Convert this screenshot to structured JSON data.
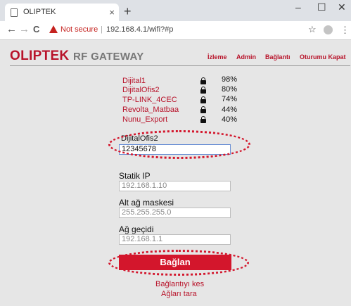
{
  "browser": {
    "tab_title": "OLIPTEK",
    "tab_close": "×",
    "new_tab": "+",
    "window_minimize": "–",
    "window_maximize": "☐",
    "window_close": "✕",
    "nav_back": "←",
    "nav_forward": "→",
    "nav_reload": "C",
    "security_label": "Not secure",
    "separator": "|",
    "url": "192.168.4.1/wifi?#p",
    "star": "☆",
    "menu": "⋮"
  },
  "header": {
    "brand": "OLIPTEK",
    "brand_sub": "RF GATEWAY",
    "nav": [
      "İzleme",
      "Admin",
      "Bağlantı",
      "Oturumu Kapat"
    ]
  },
  "networks": [
    {
      "ssid": "Dijital1",
      "signal": "98%"
    },
    {
      "ssid": "DijitalOfis2",
      "signal": "80%"
    },
    {
      "ssid": "TP-LINK_4CEC",
      "signal": "74%"
    },
    {
      "ssid": "Revolta_Matbaa",
      "signal": "44%"
    },
    {
      "ssid": "Nunu_Export",
      "signal": "40%"
    }
  ],
  "form": {
    "ssid_value": "DijitalOfis2",
    "password_value": "12345678",
    "static_ip_label": "Statik IP",
    "static_ip_placeholder": "192.168.1.10",
    "subnet_label": "Alt ağ maskesi",
    "subnet_placeholder": "255.255.255.0",
    "gateway_label": "Ağ geçidi",
    "gateway_placeholder": "192.168.1.1",
    "connect_button": "Bağlan",
    "disconnect_link": "Bağlantıyı kes",
    "scan_link": "Ağları tara"
  },
  "colors": {
    "accent": "#d3162c",
    "brand": "#b8132a",
    "background": "#e6e6e6"
  }
}
